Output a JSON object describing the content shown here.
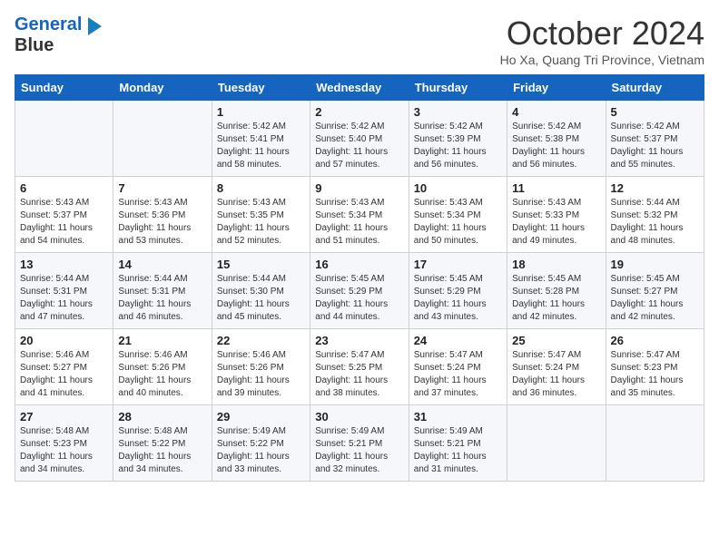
{
  "logo": {
    "line1": "General",
    "line2": "Blue"
  },
  "title": "October 2024",
  "location": "Ho Xa, Quang Tri Province, Vietnam",
  "days_header": [
    "Sunday",
    "Monday",
    "Tuesday",
    "Wednesday",
    "Thursday",
    "Friday",
    "Saturday"
  ],
  "weeks": [
    [
      {
        "day": "",
        "sunrise": "",
        "sunset": "",
        "daylight": ""
      },
      {
        "day": "",
        "sunrise": "",
        "sunset": "",
        "daylight": ""
      },
      {
        "day": "1",
        "sunrise": "Sunrise: 5:42 AM",
        "sunset": "Sunset: 5:41 PM",
        "daylight": "Daylight: 11 hours and 58 minutes."
      },
      {
        "day": "2",
        "sunrise": "Sunrise: 5:42 AM",
        "sunset": "Sunset: 5:40 PM",
        "daylight": "Daylight: 11 hours and 57 minutes."
      },
      {
        "day": "3",
        "sunrise": "Sunrise: 5:42 AM",
        "sunset": "Sunset: 5:39 PM",
        "daylight": "Daylight: 11 hours and 56 minutes."
      },
      {
        "day": "4",
        "sunrise": "Sunrise: 5:42 AM",
        "sunset": "Sunset: 5:38 PM",
        "daylight": "Daylight: 11 hours and 56 minutes."
      },
      {
        "day": "5",
        "sunrise": "Sunrise: 5:42 AM",
        "sunset": "Sunset: 5:37 PM",
        "daylight": "Daylight: 11 hours and 55 minutes."
      }
    ],
    [
      {
        "day": "6",
        "sunrise": "Sunrise: 5:43 AM",
        "sunset": "Sunset: 5:37 PM",
        "daylight": "Daylight: 11 hours and 54 minutes."
      },
      {
        "day": "7",
        "sunrise": "Sunrise: 5:43 AM",
        "sunset": "Sunset: 5:36 PM",
        "daylight": "Daylight: 11 hours and 53 minutes."
      },
      {
        "day": "8",
        "sunrise": "Sunrise: 5:43 AM",
        "sunset": "Sunset: 5:35 PM",
        "daylight": "Daylight: 11 hours and 52 minutes."
      },
      {
        "day": "9",
        "sunrise": "Sunrise: 5:43 AM",
        "sunset": "Sunset: 5:34 PM",
        "daylight": "Daylight: 11 hours and 51 minutes."
      },
      {
        "day": "10",
        "sunrise": "Sunrise: 5:43 AM",
        "sunset": "Sunset: 5:34 PM",
        "daylight": "Daylight: 11 hours and 50 minutes."
      },
      {
        "day": "11",
        "sunrise": "Sunrise: 5:43 AM",
        "sunset": "Sunset: 5:33 PM",
        "daylight": "Daylight: 11 hours and 49 minutes."
      },
      {
        "day": "12",
        "sunrise": "Sunrise: 5:44 AM",
        "sunset": "Sunset: 5:32 PM",
        "daylight": "Daylight: 11 hours and 48 minutes."
      }
    ],
    [
      {
        "day": "13",
        "sunrise": "Sunrise: 5:44 AM",
        "sunset": "Sunset: 5:31 PM",
        "daylight": "Daylight: 11 hours and 47 minutes."
      },
      {
        "day": "14",
        "sunrise": "Sunrise: 5:44 AM",
        "sunset": "Sunset: 5:31 PM",
        "daylight": "Daylight: 11 hours and 46 minutes."
      },
      {
        "day": "15",
        "sunrise": "Sunrise: 5:44 AM",
        "sunset": "Sunset: 5:30 PM",
        "daylight": "Daylight: 11 hours and 45 minutes."
      },
      {
        "day": "16",
        "sunrise": "Sunrise: 5:45 AM",
        "sunset": "Sunset: 5:29 PM",
        "daylight": "Daylight: 11 hours and 44 minutes."
      },
      {
        "day": "17",
        "sunrise": "Sunrise: 5:45 AM",
        "sunset": "Sunset: 5:29 PM",
        "daylight": "Daylight: 11 hours and 43 minutes."
      },
      {
        "day": "18",
        "sunrise": "Sunrise: 5:45 AM",
        "sunset": "Sunset: 5:28 PM",
        "daylight": "Daylight: 11 hours and 42 minutes."
      },
      {
        "day": "19",
        "sunrise": "Sunrise: 5:45 AM",
        "sunset": "Sunset: 5:27 PM",
        "daylight": "Daylight: 11 hours and 42 minutes."
      }
    ],
    [
      {
        "day": "20",
        "sunrise": "Sunrise: 5:46 AM",
        "sunset": "Sunset: 5:27 PM",
        "daylight": "Daylight: 11 hours and 41 minutes."
      },
      {
        "day": "21",
        "sunrise": "Sunrise: 5:46 AM",
        "sunset": "Sunset: 5:26 PM",
        "daylight": "Daylight: 11 hours and 40 minutes."
      },
      {
        "day": "22",
        "sunrise": "Sunrise: 5:46 AM",
        "sunset": "Sunset: 5:26 PM",
        "daylight": "Daylight: 11 hours and 39 minutes."
      },
      {
        "day": "23",
        "sunrise": "Sunrise: 5:47 AM",
        "sunset": "Sunset: 5:25 PM",
        "daylight": "Daylight: 11 hours and 38 minutes."
      },
      {
        "day": "24",
        "sunrise": "Sunrise: 5:47 AM",
        "sunset": "Sunset: 5:24 PM",
        "daylight": "Daylight: 11 hours and 37 minutes."
      },
      {
        "day": "25",
        "sunrise": "Sunrise: 5:47 AM",
        "sunset": "Sunset: 5:24 PM",
        "daylight": "Daylight: 11 hours and 36 minutes."
      },
      {
        "day": "26",
        "sunrise": "Sunrise: 5:47 AM",
        "sunset": "Sunset: 5:23 PM",
        "daylight": "Daylight: 11 hours and 35 minutes."
      }
    ],
    [
      {
        "day": "27",
        "sunrise": "Sunrise: 5:48 AM",
        "sunset": "Sunset: 5:23 PM",
        "daylight": "Daylight: 11 hours and 34 minutes."
      },
      {
        "day": "28",
        "sunrise": "Sunrise: 5:48 AM",
        "sunset": "Sunset: 5:22 PM",
        "daylight": "Daylight: 11 hours and 34 minutes."
      },
      {
        "day": "29",
        "sunrise": "Sunrise: 5:49 AM",
        "sunset": "Sunset: 5:22 PM",
        "daylight": "Daylight: 11 hours and 33 minutes."
      },
      {
        "day": "30",
        "sunrise": "Sunrise: 5:49 AM",
        "sunset": "Sunset: 5:21 PM",
        "daylight": "Daylight: 11 hours and 32 minutes."
      },
      {
        "day": "31",
        "sunrise": "Sunrise: 5:49 AM",
        "sunset": "Sunset: 5:21 PM",
        "daylight": "Daylight: 11 hours and 31 minutes."
      },
      {
        "day": "",
        "sunrise": "",
        "sunset": "",
        "daylight": ""
      },
      {
        "day": "",
        "sunrise": "",
        "sunset": "",
        "daylight": ""
      }
    ]
  ]
}
